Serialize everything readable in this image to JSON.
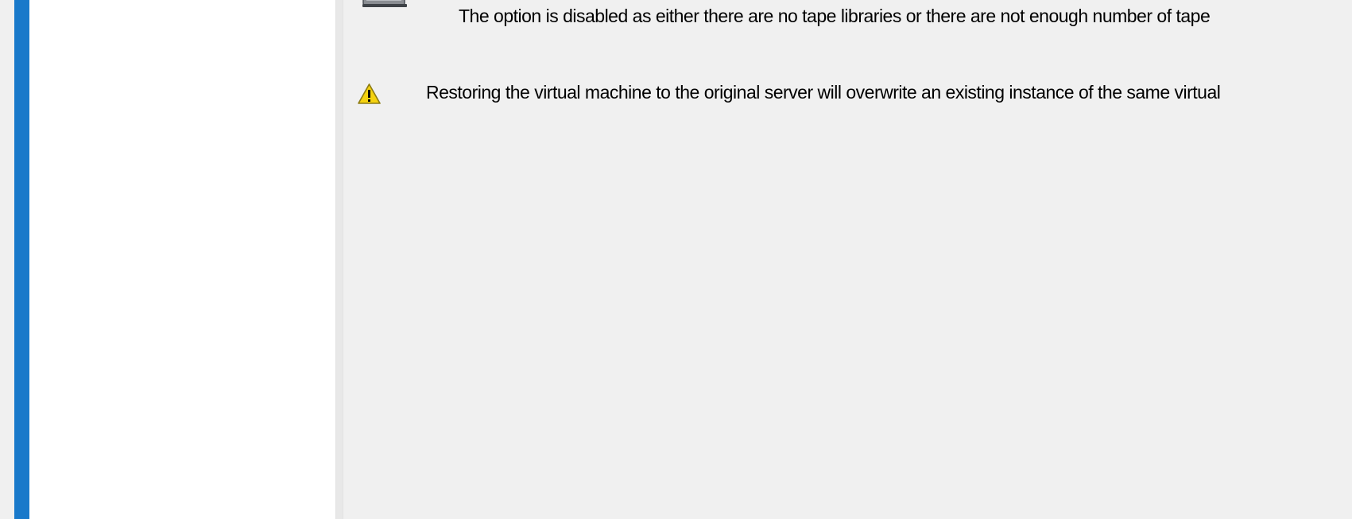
{
  "dialog": {
    "tape_option_message": "The option is disabled as either there are no tape libraries or there are not enough number of tape",
    "overwrite_warning_message": "Restoring the virtual machine to the original server will overwrite an existing instance of the same virtual"
  },
  "icons": {
    "tape_icon": "tape-library-icon",
    "warning_icon": "warning-icon"
  },
  "colors": {
    "accent": "#1979ca",
    "background": "#f0f0f0",
    "nav_pane": "#ffffff",
    "warning_fill": "#f5d20f"
  }
}
